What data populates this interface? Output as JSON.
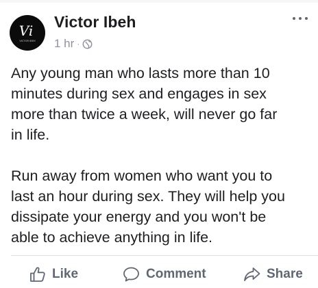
{
  "post": {
    "author": "Victor Ibeh",
    "avatar_text": "Vi",
    "avatar_subtext": "VICTOR IBEH",
    "time": "1 hr",
    "separator": "·",
    "privacy_icon": "globe-icon",
    "more_icon": "more-options-icon",
    "paragraphs": [
      "Any young man who lasts more than 10\nminutes during sex and engages in sex\nmore than twice a week, will never go far\nin life.",
      "Run away from women who want you to\nlast an hour during sex. They will help you\ndissipate your energy and you won't be\nable to achieve anything in life."
    ]
  },
  "actions": {
    "like_label": "Like",
    "comment_label": "Comment",
    "share_label": "Share",
    "like_icon": "thumbs-up-icon",
    "comment_icon": "speech-bubble-icon",
    "share_icon": "share-arrow-icon"
  },
  "colors": {
    "text": "#1c1e21",
    "meta": "#8d949e",
    "action": "#606770",
    "divider": "#dadde1",
    "avatar_bg": "#0b0b0b"
  }
}
